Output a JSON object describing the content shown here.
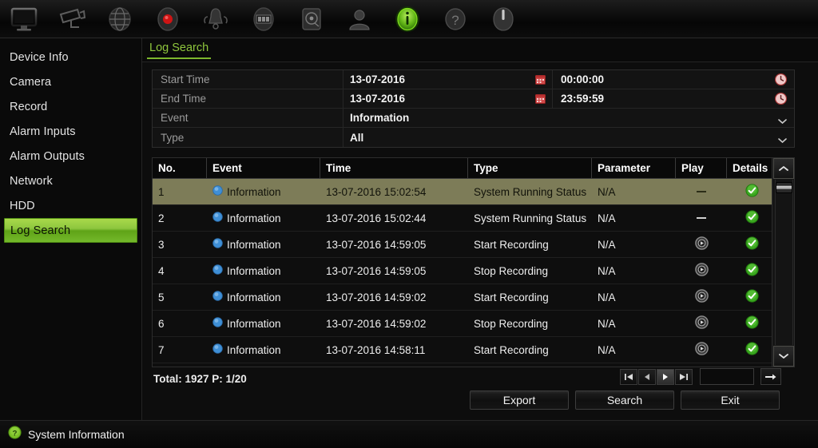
{
  "toolbar": {
    "items": [
      {
        "icon": "monitor-icon",
        "name": "live-view",
        "active": false
      },
      {
        "icon": "camera-icon",
        "name": "camera",
        "active": false
      },
      {
        "icon": "network-icon",
        "name": "network",
        "active": false
      },
      {
        "icon": "record-icon",
        "name": "record",
        "active": false
      },
      {
        "icon": "alarm-icon",
        "name": "alarm",
        "active": false
      },
      {
        "icon": "playback-icon",
        "name": "playback",
        "active": false
      },
      {
        "icon": "hdd-icon",
        "name": "hdd",
        "active": false
      },
      {
        "icon": "user-icon",
        "name": "user",
        "active": false
      },
      {
        "icon": "info-icon",
        "name": "system-information",
        "active": true
      },
      {
        "icon": "help-icon",
        "name": "help",
        "active": false
      },
      {
        "icon": "power-icon",
        "name": "shutdown",
        "active": false
      }
    ]
  },
  "sidebar": {
    "items": [
      {
        "label": "Device Info",
        "active": false
      },
      {
        "label": "Camera",
        "active": false
      },
      {
        "label": "Record",
        "active": false
      },
      {
        "label": "Alarm Inputs",
        "active": false
      },
      {
        "label": "Alarm Outputs",
        "active": false
      },
      {
        "label": "Network",
        "active": false
      },
      {
        "label": "HDD",
        "active": false
      },
      {
        "label": "Log Search",
        "active": true
      }
    ]
  },
  "tab": {
    "label": "Log Search"
  },
  "form": {
    "start_time": {
      "label": "Start Time",
      "date": "13-07-2016",
      "time": "00:00:00"
    },
    "end_time": {
      "label": "End Time",
      "date": "13-07-2016",
      "time": "23:59:59"
    },
    "event": {
      "label": "Event",
      "value": "Information"
    },
    "type": {
      "label": "Type",
      "value": "All"
    }
  },
  "table": {
    "headers": [
      "No.",
      "Event",
      "Time",
      "Type",
      "Parameter",
      "Play",
      "Details"
    ],
    "rows": [
      {
        "no": "1",
        "event": "Information",
        "time": "13-07-2016 15:02:54",
        "type": "System Running Status",
        "parameter": "N/A",
        "play": "dash",
        "details": "check",
        "selected": true
      },
      {
        "no": "2",
        "event": "Information",
        "time": "13-07-2016 15:02:44",
        "type": "System Running Status",
        "parameter": "N/A",
        "play": "dash",
        "details": "check",
        "selected": false
      },
      {
        "no": "3",
        "event": "Information",
        "time": "13-07-2016 14:59:05",
        "type": "Start Recording",
        "parameter": "N/A",
        "play": "play",
        "details": "check",
        "selected": false
      },
      {
        "no": "4",
        "event": "Information",
        "time": "13-07-2016 14:59:05",
        "type": "Stop Recording",
        "parameter": "N/A",
        "play": "play",
        "details": "check",
        "selected": false
      },
      {
        "no": "5",
        "event": "Information",
        "time": "13-07-2016 14:59:02",
        "type": "Start Recording",
        "parameter": "N/A",
        "play": "play",
        "details": "check",
        "selected": false
      },
      {
        "no": "6",
        "event": "Information",
        "time": "13-07-2016 14:59:02",
        "type": "Stop Recording",
        "parameter": "N/A",
        "play": "play",
        "details": "check",
        "selected": false
      },
      {
        "no": "7",
        "event": "Information",
        "time": "13-07-2016 14:58:11",
        "type": "Start Recording",
        "parameter": "N/A",
        "play": "play",
        "details": "check",
        "selected": false
      }
    ]
  },
  "footer": {
    "total_text": "Total: 1927  P: 1/20",
    "page_input_value": "",
    "pager": {
      "first": "first-page",
      "prev": "previous-page",
      "next": "next-page",
      "last": "last-page",
      "go": "go-to-page"
    },
    "buttons": [
      {
        "label": "Export"
      },
      {
        "label": "Search"
      },
      {
        "label": "Exit"
      }
    ]
  },
  "statusbar": {
    "text": "System Information",
    "icon": "info-circle-icon"
  },
  "colors": {
    "accent_green": "#8dc63f",
    "selection_olive": "#7d7c58",
    "status_ok": "#3fae2a",
    "panel_bg": "#0d0d0d"
  }
}
